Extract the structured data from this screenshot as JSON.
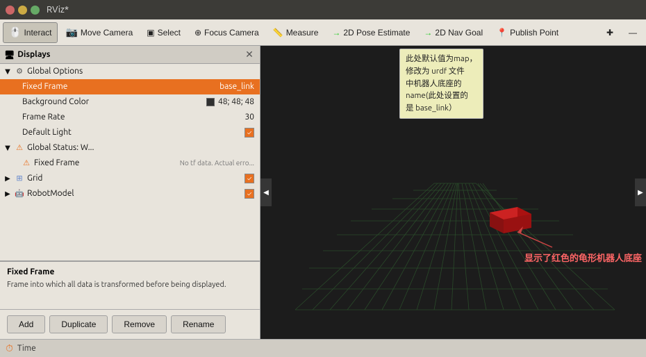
{
  "titlebar": {
    "title": "RViz*"
  },
  "toolbar": {
    "interact_label": "Interact",
    "move_camera_label": "Move Camera",
    "select_label": "Select",
    "focus_camera_label": "Focus Camera",
    "measure_label": "Measure",
    "pose_estimate_label": "2D Pose Estimate",
    "nav_goal_label": "2D Nav Goal",
    "publish_point_label": "Publish Point",
    "plus_label": "+",
    "minus_label": "—"
  },
  "displays_panel": {
    "header": "Displays",
    "tree": {
      "global_options_label": "Global Options",
      "fixed_frame_label": "Fixed Frame",
      "fixed_frame_value": "base_link",
      "background_color_label": "Background Color",
      "background_color_value": "48; 48; 48",
      "frame_rate_label": "Frame Rate",
      "frame_rate_value": "30",
      "default_light_label": "Default Light",
      "global_status_label": "Global Status: W...",
      "fixed_frame_status_label": "Fixed Frame",
      "fixed_frame_status_value": "No tf data.  Actual erro...",
      "grid_label": "Grid",
      "robot_model_label": "RobotModel"
    }
  },
  "annotation": {
    "line1": "此处默认值为map，",
    "line2": "修改为 urdf 文件",
    "line3": "中机器人底座的",
    "line4": "name(此处设置的",
    "line5": "是 base_link）"
  },
  "description": {
    "title": "Fixed Frame",
    "text": "Frame into which all data is transformed before\nbeing displayed."
  },
  "buttons": {
    "add_label": "Add",
    "duplicate_label": "Duplicate",
    "remove_label": "Remove",
    "rename_label": "Rename"
  },
  "viewport": {
    "annotation_text": "显示了红色的龟形机器人底座",
    "arrow_text": ""
  },
  "statusbar": {
    "icon": "⏱",
    "label": "Time"
  },
  "colors": {
    "orange": "#e87020",
    "dark_bg": "#1a1a1a",
    "grid_color": "#3a5a3a",
    "robot_red": "#cc2222"
  }
}
